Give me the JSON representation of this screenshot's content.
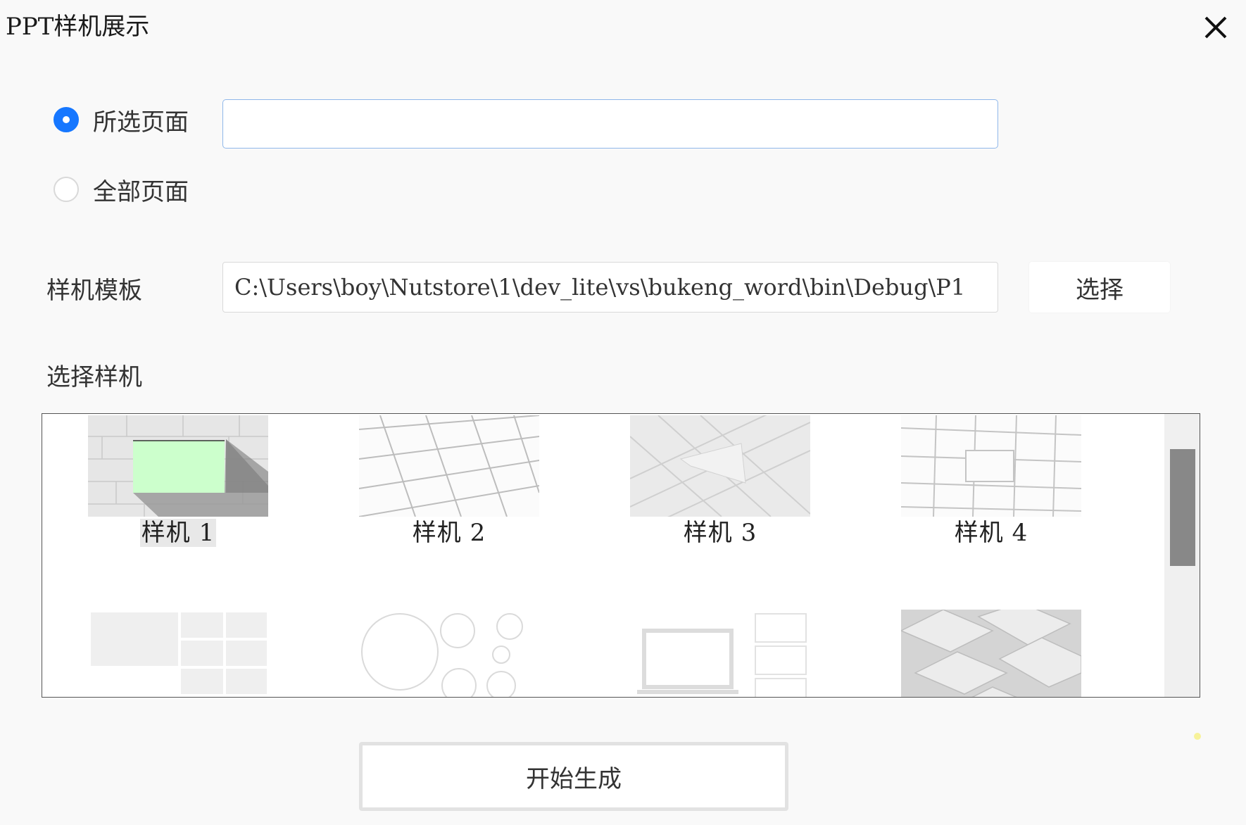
{
  "dialog": {
    "title": "PPT样机展示"
  },
  "page_range": {
    "selected_label": "所选页面",
    "all_label": "全部页面",
    "selected_value": "",
    "choice": "selected"
  },
  "template": {
    "label": "样机模板",
    "path": "C:\\Users\\boy\\Nutstore\\1\\dev_lite\\vs\\bukeng_word\\bin\\Debug\\P1",
    "choose_button": "选择"
  },
  "gallery": {
    "label": "选择样机",
    "items": [
      {
        "caption": "样机 1",
        "selected": true
      },
      {
        "caption": "样机 2",
        "selected": false
      },
      {
        "caption": "样机 3",
        "selected": false
      },
      {
        "caption": "样机 4",
        "selected": false
      },
      {
        "caption": "",
        "selected": false
      },
      {
        "caption": "",
        "selected": false
      },
      {
        "caption": "",
        "selected": false
      },
      {
        "caption": "",
        "selected": false
      }
    ]
  },
  "footer": {
    "generate_button": "开始生成"
  },
  "icons": {
    "close": "close-icon"
  },
  "colors": {
    "accent": "#1677ff",
    "input_border_focus": "#8fb7ea",
    "mockup_screen": "#ccffcc"
  }
}
